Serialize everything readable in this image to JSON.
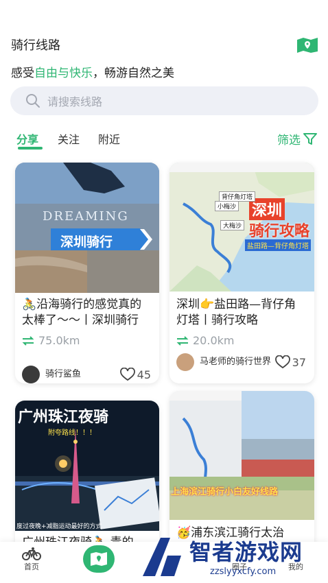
{
  "header": {
    "title": "骑行线路",
    "subtitle_pre": "感受",
    "subtitle_hl": "自由与快乐",
    "subtitle_post": "，畅游自然之美"
  },
  "search": {
    "placeholder": "请搜索线路"
  },
  "tabs": [
    {
      "label": "分享",
      "active": true
    },
    {
      "label": "关注",
      "active": false
    },
    {
      "label": "附近",
      "active": false
    }
  ],
  "filter_label": "筛选",
  "cards": [
    {
      "image_texts": [
        "DREAMING",
        "深圳骑行"
      ],
      "title": "🚴沿海骑行的感觉真的太棒了～～丨深圳骑行",
      "distance": "75.0km",
      "author": "骑行鲨鱼",
      "likes": "45"
    },
    {
      "image_texts": [
        "深圳",
        "骑行攻略",
        "盐田路—背仔角灯塔"
      ],
      "map_labels": [
        "小梅沙",
        "大梅沙",
        "背仔角灯塔"
      ],
      "title": "深圳👉盐田路—背仔角灯塔丨骑行攻略",
      "distance": "20.0km",
      "author": "马老师的骑行世界",
      "likes": "37"
    },
    {
      "image_texts": [
        "广州珠江夜骑",
        "附夸路线！！！",
        "度过夜晚+减脂运动最好的方式"
      ],
      "title": "广州珠江夜骑🚴 青的"
    },
    {
      "image_texts": [
        "上海滨江骑行小白友好线路"
      ],
      "title": "🥳浦东滨江骑行太治"
    }
  ],
  "tabbar": {
    "home": "首页",
    "circle": "圈子",
    "mine": "我的"
  },
  "watermark": {
    "name": "智者游戏网",
    "url": "zzslyyxcfy.com"
  },
  "colors": {
    "accent": "#2fb673",
    "search_bg": "#eef0f6"
  }
}
